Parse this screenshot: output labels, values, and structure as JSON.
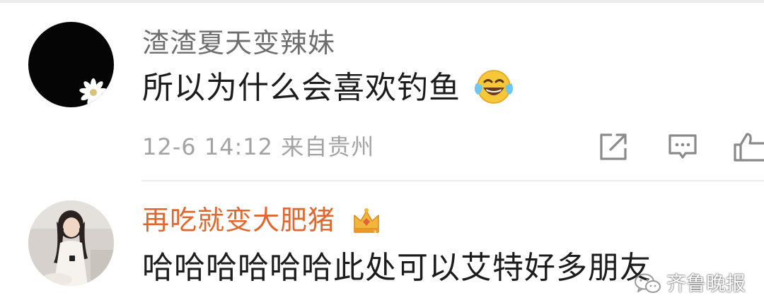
{
  "comments": [
    {
      "username": "渣渣夏天变辣妹",
      "text": "所以为什么会喜欢钓鱼",
      "timestamp": "12-6 14:12",
      "location": "来自贵州",
      "emoji": "laughing-tears-emoji",
      "username_color": "#6e6e6e"
    },
    {
      "username": "再吃就变大肥猪",
      "text": "哈哈哈哈哈哈此处可以艾特好多朋友",
      "badge": "crown-icon",
      "username_color": "#e0682f"
    }
  ],
  "actions": [
    "share-icon",
    "reply-icon",
    "like-icon"
  ],
  "watermark": {
    "text": "齐鲁晚报",
    "icon": "wechat-icon"
  }
}
